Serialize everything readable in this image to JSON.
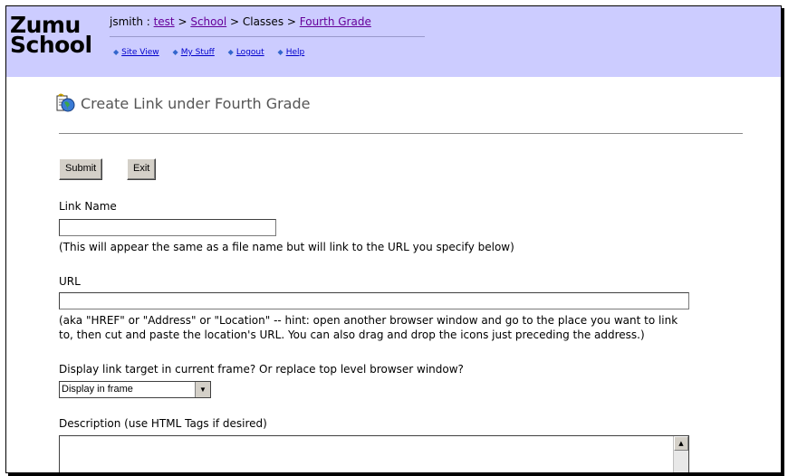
{
  "logo": {
    "line1": "Zumu",
    "line2": "School"
  },
  "breadcrumb": {
    "user": "jsmith",
    "sep_colon": " : ",
    "crumbs": [
      "test",
      "School",
      "Classes",
      "Fourth Grade"
    ],
    "sep": " > "
  },
  "nav": {
    "items": [
      "Site View",
      "My Stuff",
      "Logout",
      "Help"
    ]
  },
  "page": {
    "title": "Create Link under Fourth Grade"
  },
  "buttons": {
    "submit": "Submit",
    "exit": "Exit"
  },
  "form": {
    "link_name_label": "Link Name",
    "link_name_value": "",
    "link_name_hint": "(This will appear the same as a file name but will link to the URL you specify below)",
    "url_label": "URL",
    "url_value": "",
    "url_hint_1": "(aka \"HREF\" or \"Address\" or \"Location\" -- hint: open another browser window and go to the place you want to link",
    "url_hint_2": "to, then cut and paste the location's URL. You can also drag and drop the icons just preceding the address.)",
    "target_label": "Display link target in current frame? Or replace top level browser window?",
    "target_selected": "Display in frame",
    "description_label": "Description (use HTML Tags if desired)",
    "description_value": ""
  },
  "colors": {
    "header_bg": "#ccccff",
    "link": "#660099"
  }
}
